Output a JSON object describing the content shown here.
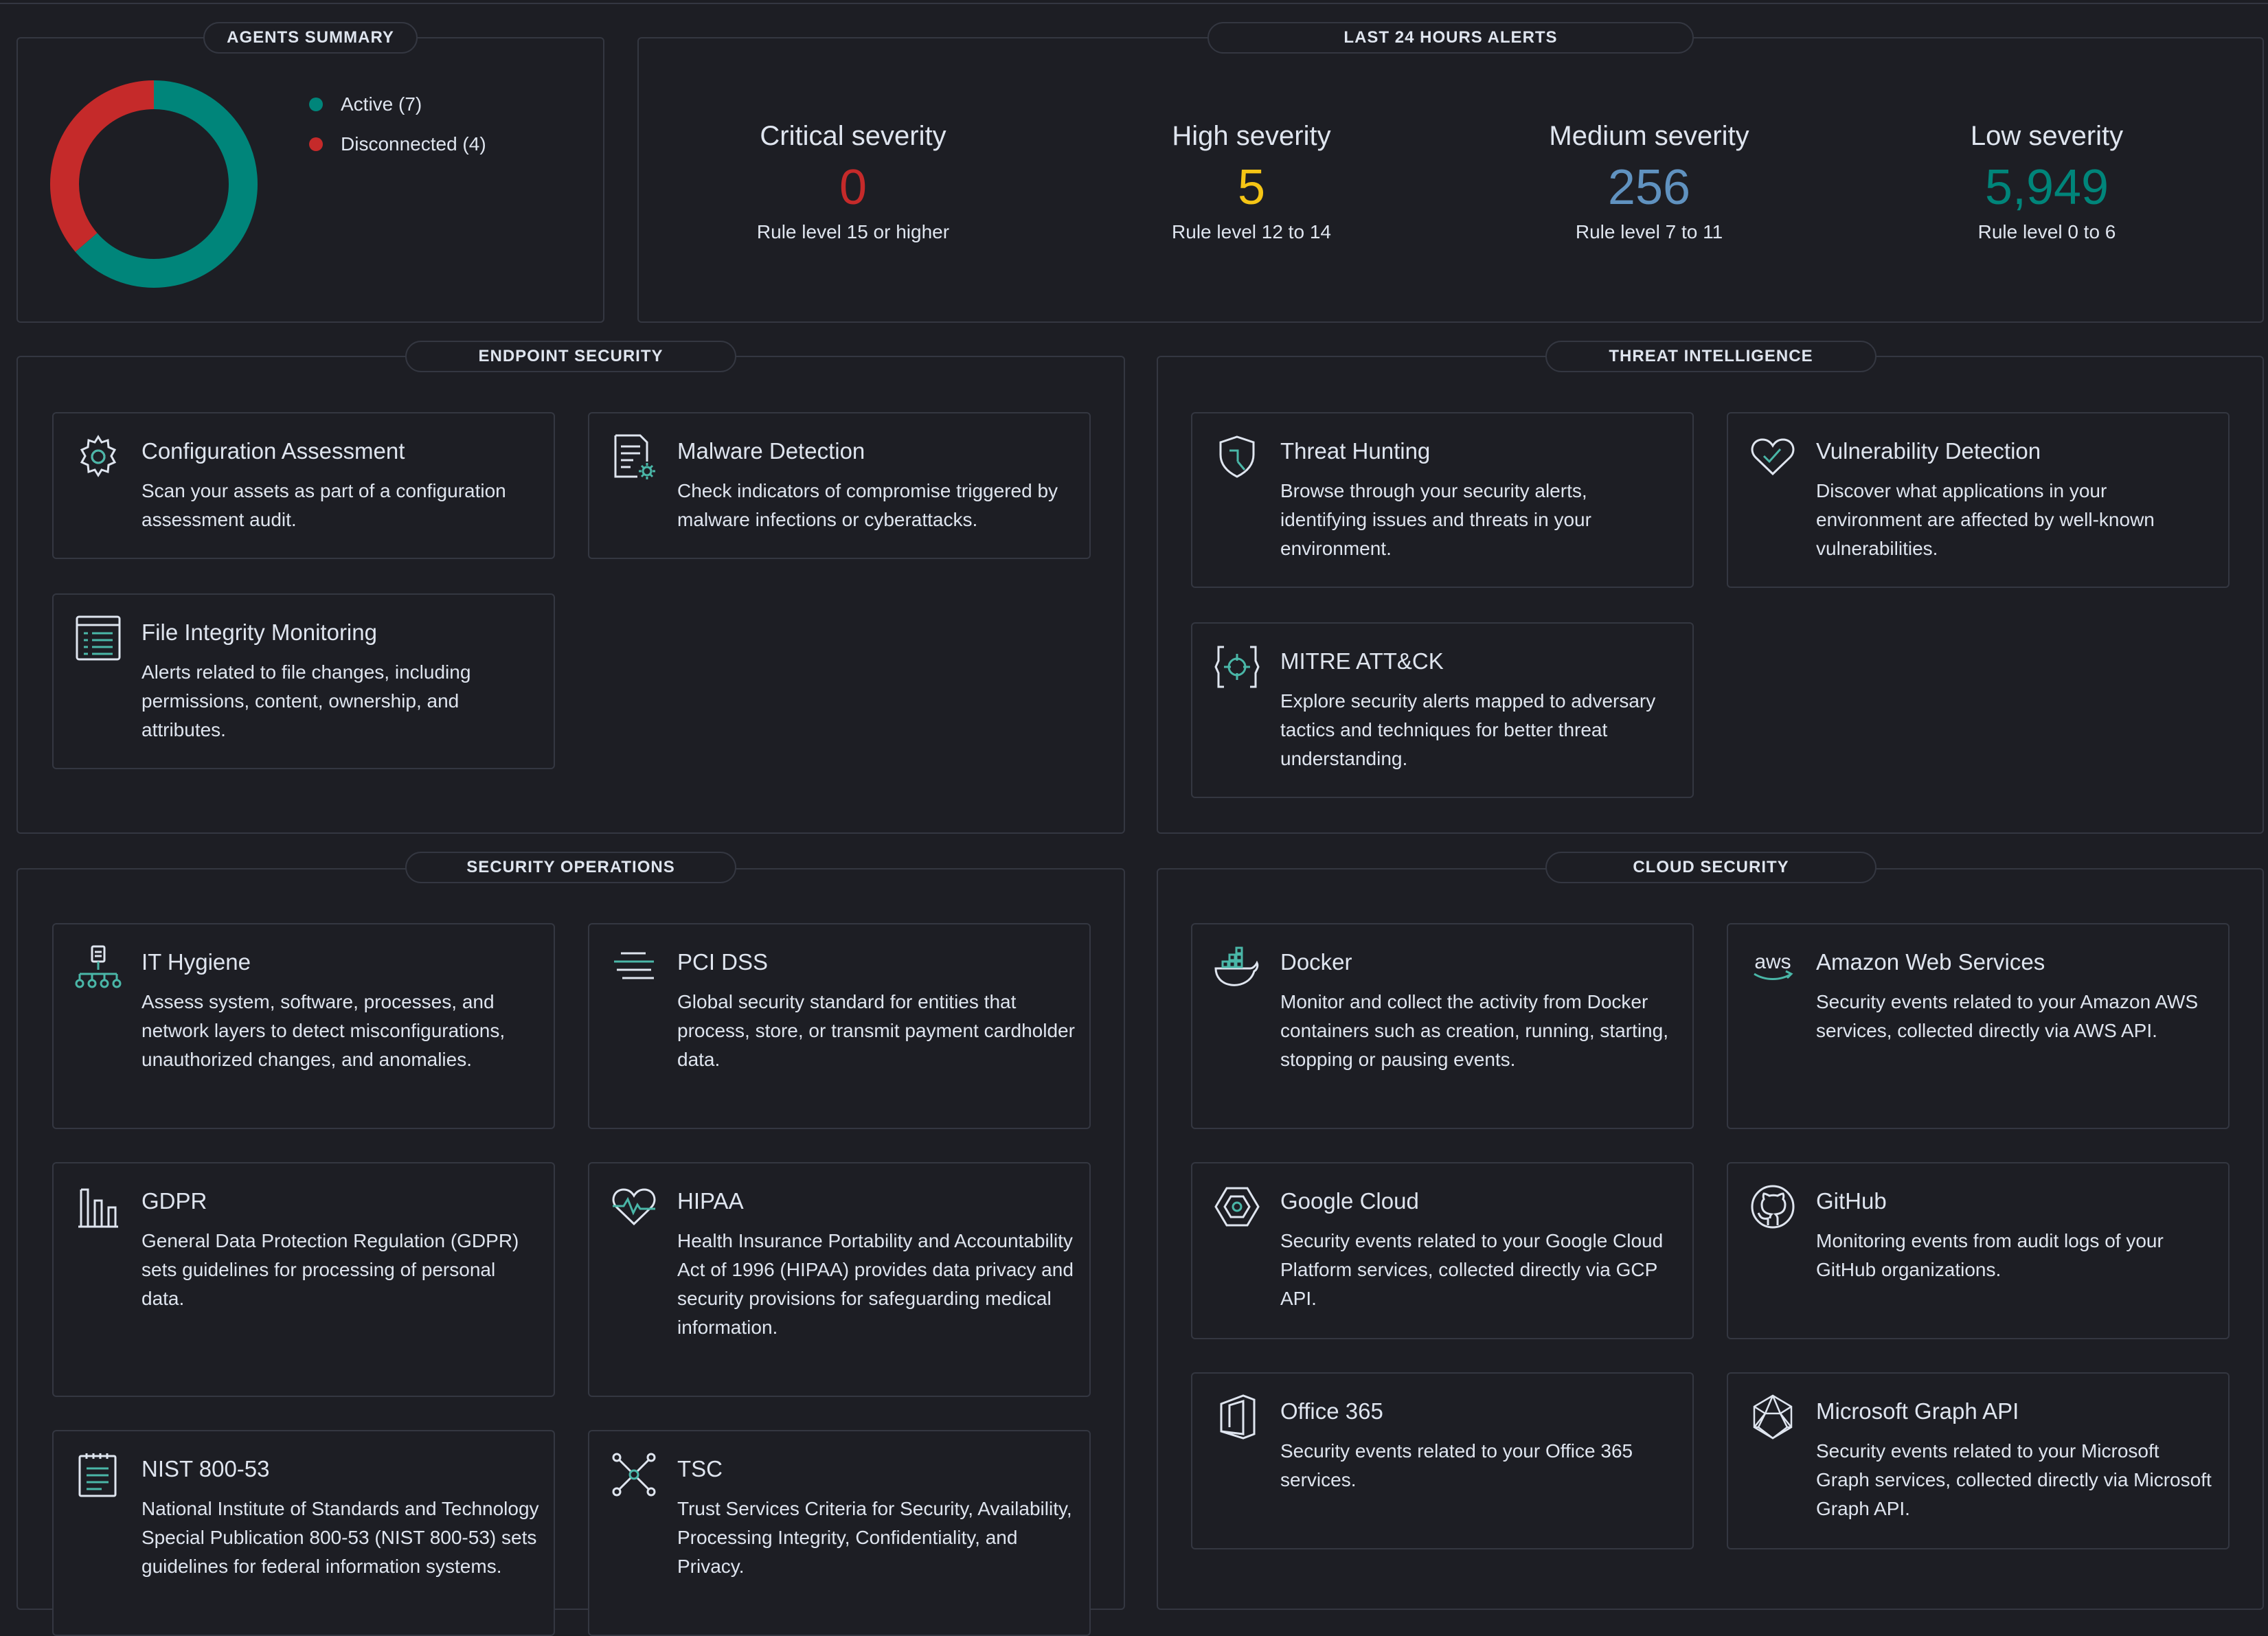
{
  "agents_summary": {
    "title": "AGENTS SUMMARY",
    "active_label": "Active (7)",
    "disconnected_label": "Disconnected (4)",
    "active_count": 7,
    "disconnected_count": 4,
    "active_color": "#00857a",
    "disconnected_color": "#c52a2a"
  },
  "alerts": {
    "title": "LAST 24 HOURS ALERTS",
    "critical": {
      "label": "Critical severity",
      "value": "0",
      "sub": "Rule level 15 or higher",
      "color": "#c52a2a"
    },
    "high": {
      "label": "High severity",
      "value": "5",
      "sub": "Rule level 12 to 14",
      "color": "#f5c515"
    },
    "medium": {
      "label": "Medium severity",
      "value": "256",
      "sub": "Rule level 7 to 11",
      "color": "#6092c0"
    },
    "low": {
      "label": "Low severity",
      "value": "5,949",
      "sub": "Rule level 0 to 6",
      "color": "#00857a"
    }
  },
  "endpoint": {
    "title": "ENDPOINT SECURITY",
    "config": {
      "icon": "gear-icon",
      "title": "Configuration Assessment",
      "desc": "Scan your assets as part of a configuration assessment audit."
    },
    "malware": {
      "icon": "document-gear-icon",
      "title": "Malware Detection",
      "desc": "Check indicators of compromise triggered by malware infections or cyberattacks."
    },
    "fim": {
      "icon": "list-icon",
      "title": "File Integrity Monitoring",
      "desc": "Alerts related to file changes, including permissions, content, ownership, and attributes."
    }
  },
  "threat": {
    "title": "THREAT INTELLIGENCE",
    "hunting": {
      "icon": "shield-hunt-icon",
      "title": "Threat Hunting",
      "desc": "Browse through your security alerts, identifying issues and threats in your environment."
    },
    "vuln": {
      "icon": "heart-check-icon",
      "title": "Vulnerability Detection",
      "desc": "Discover what applications in your environment are affected by well-known vulnerabilities."
    },
    "mitre": {
      "icon": "target-brackets-icon",
      "title": "MITRE ATT&CK",
      "desc": "Explore security alerts mapped to adversary tactics and techniques for better threat understanding."
    }
  },
  "secops": {
    "title": "SECURITY OPERATIONS",
    "ithygiene": {
      "icon": "network-tree-icon",
      "title": "IT Hygiene",
      "desc": "Assess system, software, processes, and network layers to detect misconfigurations, unauthorized changes, and anomalies."
    },
    "pci": {
      "icon": "lines-icon",
      "title": "PCI DSS",
      "desc": "Global security standard for entities that process, store, or transmit payment cardholder data."
    },
    "gdpr": {
      "icon": "building-columns-icon",
      "title": "GDPR",
      "desc": "General Data Protection Regulation (GDPR) sets guidelines for processing of personal data."
    },
    "hipaa": {
      "icon": "heart-pulse-icon",
      "title": "HIPAA",
      "desc": "Health Insurance Portability and Accountability Act of 1996 (HIPAA) provides data privacy and security provisions for safeguarding medical information."
    },
    "nist": {
      "icon": "notepad-icon",
      "title": "NIST 800-53",
      "desc": "National Institute of Standards and Technology Special Publication 800-53 (NIST 800-53) sets guidelines for federal information systems."
    },
    "tsc": {
      "icon": "nodes-icon",
      "title": "TSC",
      "desc": "Trust Services Criteria for Security, Availability, Processing Integrity, Confidentiality, and Privacy."
    }
  },
  "cloud": {
    "title": "CLOUD SECURITY",
    "docker": {
      "icon": "docker-icon",
      "title": "Docker",
      "desc": "Monitor and collect the activity from Docker containers such as creation, running, starting, stopping or pausing events."
    },
    "aws": {
      "icon": "aws-icon",
      "icon_text": "aws",
      "title": "Amazon Web Services",
      "desc": "Security events related to your Amazon AWS services, collected directly via AWS API."
    },
    "gcp": {
      "icon": "google-cloud-icon",
      "title": "Google Cloud",
      "desc": "Security events related to your Google Cloud Platform services, collected directly via GCP API."
    },
    "github": {
      "icon": "github-icon",
      "title": "GitHub",
      "desc": "Monitoring events from audit logs of your GitHub organizations."
    },
    "office": {
      "icon": "office-icon",
      "title": "Office 365",
      "desc": "Security events related to your Office 365 services."
    },
    "msgraph": {
      "icon": "graph-icon",
      "title": "Microsoft Graph API",
      "desc": "Security events related to your Microsoft Graph services, collected directly via Microsoft Graph API."
    }
  }
}
